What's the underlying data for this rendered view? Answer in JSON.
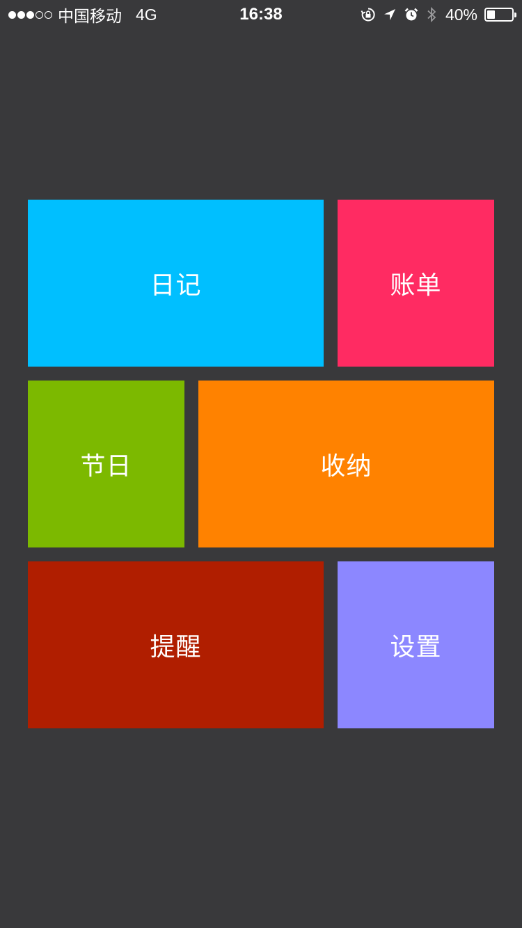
{
  "status_bar": {
    "signal_dots": [
      true,
      true,
      true,
      false,
      false
    ],
    "carrier": "中国移动",
    "network": "4G",
    "time": "16:38",
    "icons": [
      "orientation-lock-icon",
      "location-arrow-icon",
      "alarm-clock-icon",
      "bluetooth-icon"
    ],
    "battery_percent_label": "40%",
    "battery_level": 0.4
  },
  "tiles": [
    {
      "id": "diary",
      "label": "日记",
      "color": "#00bfff"
    },
    {
      "id": "bill",
      "label": "账单",
      "color": "#ff2b62"
    },
    {
      "id": "festival",
      "label": "节日",
      "color": "#7cb900"
    },
    {
      "id": "storage",
      "label": "收纳",
      "color": "#ff8200"
    },
    {
      "id": "reminder",
      "label": "提醒",
      "color": "#b01e00"
    },
    {
      "id": "settings",
      "label": "设置",
      "color": "#8c87ff"
    }
  ],
  "colors": {
    "background": "#39393b",
    "text": "#ffffff"
  }
}
